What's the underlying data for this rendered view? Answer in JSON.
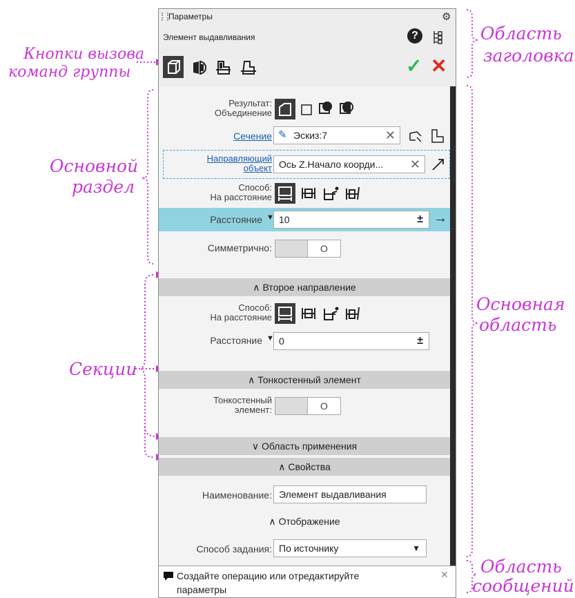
{
  "annotations": {
    "group_buttons": [
      "Кнопки вызова",
      "команд группы"
    ],
    "header_area": [
      "Область",
      "заголовка"
    ],
    "main_section": [
      "Основной",
      "раздел"
    ],
    "main_area": [
      "Основная",
      "область"
    ],
    "sections": "Секции",
    "message_area": [
      "Область",
      "сообщений"
    ]
  },
  "header": {
    "title": "Параметры",
    "subtitle": "Элемент выдавливания",
    "icons": [
      "gear-icon",
      "help-icon",
      "tree-icon",
      "extrude-icon",
      "rotate-icon",
      "kinematic-icon",
      "loft-icon",
      "ok-checkmark-icon",
      "cancel-cross-icon"
    ],
    "accent_ok": "#2fb84a",
    "accent_cancel": "#e0261f"
  },
  "main": {
    "result_label": "Результат:",
    "result_value": "Объединение",
    "section_label": "Сечение",
    "section_value": "Эскиз:7",
    "guide_label_1": "Направляющий",
    "guide_label_2": "объект",
    "guide_value": "Ось Z.Начало коорди...",
    "method_label": "Способ:",
    "method_value": "На расстояние",
    "distance_label": "Расстояние",
    "distance_value": "10",
    "symmetric_label": "Симметрично:",
    "toggle_off": "O",
    "highlight_color": "#8fd3e0"
  },
  "second_direction": {
    "title": "Второе направление",
    "method_label": "Способ:",
    "method_value": "На расстояние",
    "distance_label": "Расстояние",
    "distance_value": "0"
  },
  "thin_wall": {
    "title": "Тонкостенный элемент",
    "label_1": "Тонкостенный",
    "label_2": "элемент:",
    "toggle_off": "O"
  },
  "scope": {
    "title": "Область применения"
  },
  "properties": {
    "title": "Свойства",
    "name_label": "Наименование:",
    "name_value": "Элемент выдавливания",
    "display_title": "Отображение",
    "mode_label": "Способ задания:",
    "mode_value": "По источнику"
  },
  "message": {
    "text_1": "Создайте операцию или отредактируйте",
    "text_2": "параметры"
  }
}
